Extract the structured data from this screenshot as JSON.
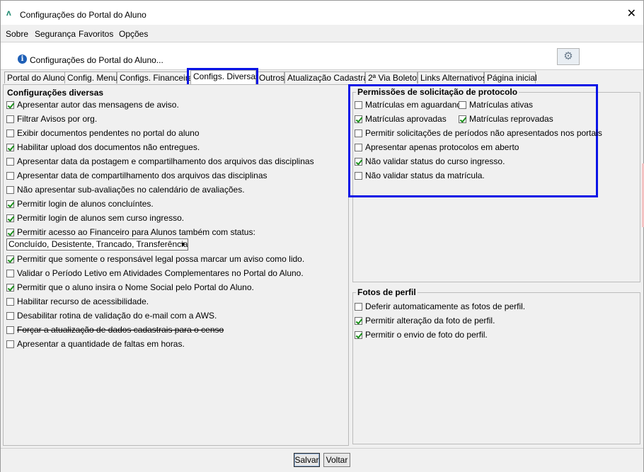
{
  "window": {
    "title": "Configurações do Portal do Aluno",
    "close": "✕",
    "app_icon": "ʌ"
  },
  "menu": [
    "Sobre",
    "Segurança",
    "Favoritos",
    "Opções"
  ],
  "info": {
    "text": "Configurações do Portal do Aluno...",
    "icon": "i"
  },
  "tabs": [
    "Portal do Aluno",
    "Config. Menu",
    "Configs. Financeiras",
    "Configs. Diversas",
    "Outros",
    "Atualização Cadastral",
    "2ª Via Boleto",
    "Links Alternativos",
    "Página inicial"
  ],
  "left": {
    "title": "Configurações diversas",
    "items": [
      {
        "label": "Apresentar autor das mensagens de aviso.",
        "checked": true
      },
      {
        "label": "Filtrar Avisos por org.",
        "checked": false
      },
      {
        "label": "Exibir documentos pendentes no portal do aluno",
        "checked": false
      },
      {
        "label": "Habilitar upload dos documentos não entregues.",
        "checked": true
      },
      {
        "label": "Apresentar data da postagem e compartilhamento dos arquivos das disciplinas",
        "checked": false
      },
      {
        "label": "Apresentar data de compartilhamento dos arquivos das disciplinas",
        "checked": false
      },
      {
        "label": "Não apresentar sub-avaliações no calendário de avaliações.",
        "checked": false
      },
      {
        "label": "Permitir login de alunos concluíntes.",
        "checked": true
      },
      {
        "label": "Permitir login de alunos sem curso ingresso.",
        "checked": true
      },
      {
        "label": "Permitir acesso ao Financeiro para Alunos também com status:",
        "checked": true
      }
    ],
    "status_select": "Concluído, Desistente, Trancado, Transferência I...",
    "items2": [
      {
        "label": "Permitir que somente o responsável legal possa marcar um aviso como lido.",
        "checked": true
      },
      {
        "label": "Validar o Período Letivo em Atividades Complementares no Portal do Aluno.",
        "checked": false
      },
      {
        "label": "Permitir que o aluno insira o Nome Social pelo Portal do Aluno.",
        "checked": true
      },
      {
        "label": "Habilitar recurso de acessibilidade.",
        "checked": false
      },
      {
        "label": "Desabilitar rotina de validação do e-mail com a AWS.",
        "checked": false
      },
      {
        "label": "Forçar a atualização de dados cadastrais para o censo",
        "checked": false
      },
      {
        "label": "Apresentar a quantidade de faltas em horas.",
        "checked": false
      }
    ]
  },
  "protocolo": {
    "title": "Permissões de solicitação de protocolo",
    "aguardando": {
      "label": "Matrículas em aguardando",
      "checked": false
    },
    "ativas": {
      "label": "Matrículas ativas",
      "checked": false
    },
    "aprovadas": {
      "label": "Matrículas aprovadas",
      "checked": true
    },
    "reprovadas": {
      "label": "Matrículas reprovadas",
      "checked": true
    },
    "periodos": {
      "label": "Permitir solicitações de períodos não apresentados nos portais",
      "checked": false
    },
    "aberto": {
      "label": "Apresentar apenas protocolos em aberto",
      "checked": false
    },
    "curso": {
      "label": "Não validar status do curso ingresso.",
      "checked": true
    },
    "matricula": {
      "label": "Não validar status da matrícula.",
      "checked": false
    }
  },
  "fotos": {
    "title": "Fotos de perfil",
    "items": [
      {
        "label": "Deferir automaticamente as fotos de perfil.",
        "checked": false
      },
      {
        "label": "Permitir alteração da foto de perfil.",
        "checked": true
      },
      {
        "label": "Permitir o envio de foto do perfil.",
        "checked": true
      }
    ]
  },
  "buttons": {
    "save": "Salvar",
    "back": "Voltar"
  },
  "colors": {
    "highlight": "#0a14e6",
    "check": "#1a8f1a"
  }
}
